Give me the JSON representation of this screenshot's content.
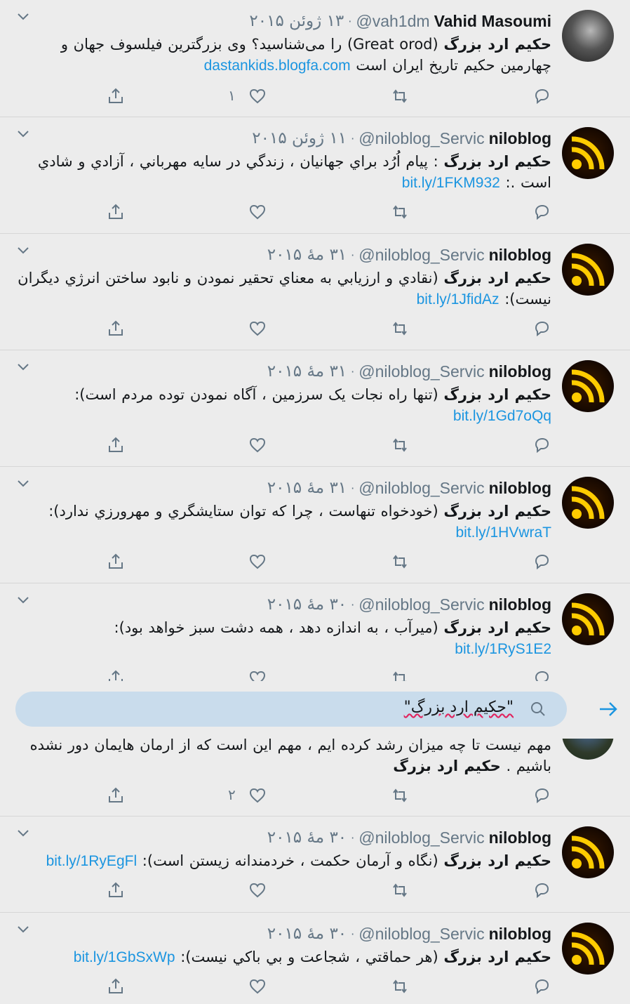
{
  "tweets": [
    {
      "name": "Vahid Masoumi",
      "handle": "@vah1dm",
      "date": "۱۳ ژوئن ۲۰۱۵",
      "bold": "حکیم ارد بزرگ",
      "text": " (Great orod) را می‌شناسید؟ وی بزرگترین فیلسوف جهان و چهارمین حکیم تاریخ ایران است ",
      "link": "dastankids.blogfa.com",
      "like_count": "۱",
      "reply_count": "",
      "avatar": "person"
    },
    {
      "name": "niloblog",
      "handle": "@niloblog_Servic",
      "date": "۱۱ ژوئن ۲۰۱۵",
      "bold": "حکیم ارد بزرگ",
      "text": " : پيام اُرُد براي جهانيان ، زندگي در سايه مهرباني ، آزادي و شادي است .: ",
      "link": "bit.ly/1FKM932",
      "like_count": "",
      "avatar": "rss"
    },
    {
      "name": "niloblog",
      "handle": "@niloblog_Servic",
      "date": "۳۱ مهٔ ۲۰۱۵",
      "bold": "حکیم ارد بزرگ",
      "text": " (نقادي و ارزيابي به معناي تحقير نمودن و نابود ساختن انرژي ديگران نيست): ",
      "link": "bit.ly/1JfidAz",
      "like_count": "",
      "avatar": "rss"
    },
    {
      "name": "niloblog",
      "handle": "@niloblog_Servic",
      "date": "۳۱ مهٔ ۲۰۱۵",
      "bold": "حکیم ارد بزرگ",
      "text": " (تنها راه نجات یک سرزمین ، آگاه نمودن توده مردم است): ",
      "link": "bit.ly/1Gd7oQq",
      "like_count": "",
      "avatar": "rss"
    },
    {
      "name": "niloblog",
      "handle": "@niloblog_Servic",
      "date": "۳۱ مهٔ ۲۰۱۵",
      "bold": "حکیم ارد بزرگ",
      "text": " (خودخواه تنهاست ، چرا که توان ستايشگري و مهرورزي ندارد): ",
      "link": "bit.ly/1HVwraT",
      "like_count": "",
      "avatar": "rss"
    },
    {
      "name": "niloblog",
      "handle": "@niloblog_Servic",
      "date": "۳۰ مهٔ ۲۰۱۵",
      "bold": "حکیم ارد بزرگ",
      "text": " (میرآب ، به اندازه دهد ، همه دشت سبز خواهد بود): ",
      "link": "bit.ly/1RyS1E2",
      "like_count": "",
      "avatar": "rss"
    },
    {
      "text": "مهم نیست تا چه میزان رشد کرده ایم ، مهم این است که از ارمان هایمان دور نشده باشیم . ",
      "bold": "حکیم ارد بزرگ",
      "like_count": "۲",
      "avatar": "partial"
    },
    {
      "name": "niloblog",
      "handle": "@niloblog_Servic",
      "date": "۳۰ مهٔ ۲۰۱۵",
      "bold": "حکیم ارد بزرگ",
      "text": " (نگاه و آرمان حکمت ، خردمندانه زیستن است): ",
      "link": "bit.ly/1RyEgFl",
      "like_count": "",
      "avatar": "rss"
    },
    {
      "name": "niloblog",
      "handle": "@niloblog_Servic",
      "date": "۳۰ مهٔ ۲۰۱۵",
      "bold": "حکیم ارد بزرگ",
      "text": " (هر حماقتي ، شجاعت و بي باکي نيست): ",
      "link": "bit.ly/1GbSxWp",
      "like_count": "",
      "avatar": "rss"
    }
  ],
  "search": {
    "query": "\"حکیم ارد بزرگ\""
  },
  "icons": {
    "reply": "reply-icon",
    "retweet": "retweet-icon",
    "like": "like-icon",
    "share": "share-icon",
    "search": "search-icon",
    "arrow": "arrow-right-icon",
    "caret": "chevron-down-icon"
  },
  "colors": {
    "link": "#1b95e0",
    "muted": "#657786",
    "search_bg": "#c9dcec",
    "background": "#ececec"
  }
}
